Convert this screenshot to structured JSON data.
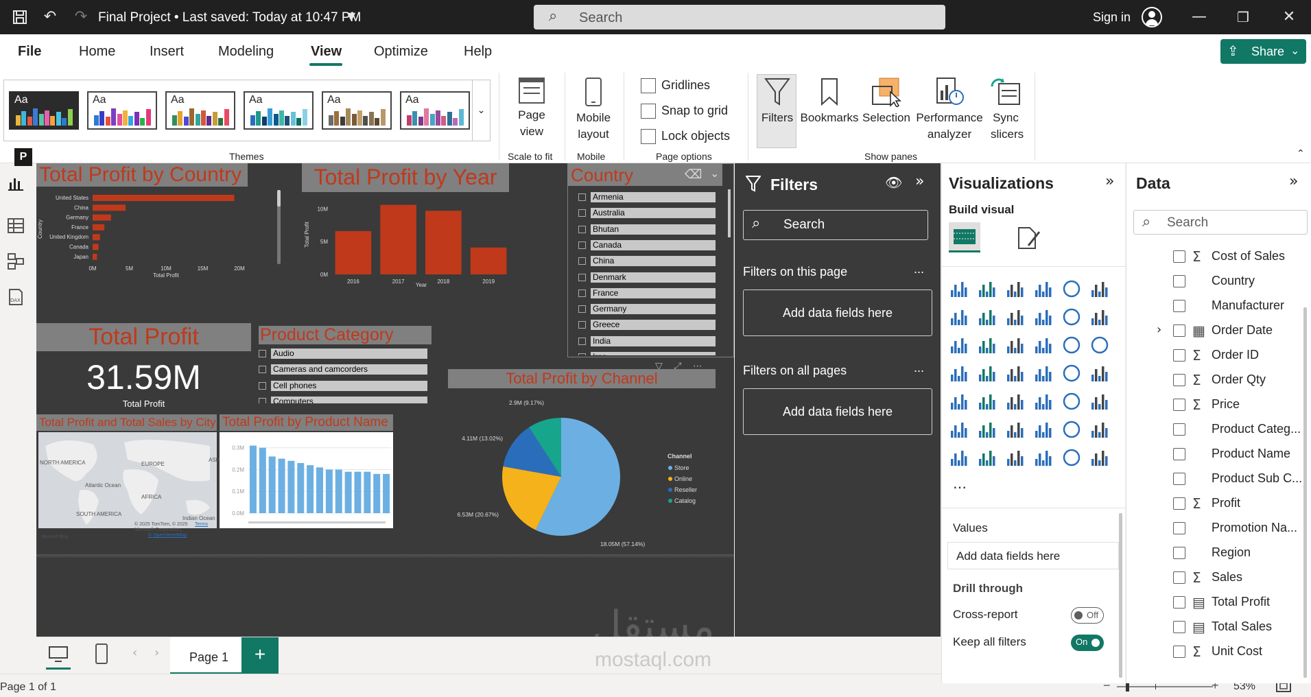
{
  "titlebar": {
    "doc_title": "Final Project • Last saved: Today at 10:47 PM",
    "search_placeholder": "Search",
    "signin": "Sign in"
  },
  "menu": {
    "items": [
      "File",
      "Home",
      "Insert",
      "Modeling",
      "View",
      "Optimize",
      "Help"
    ],
    "active": "View",
    "share": "Share"
  },
  "ribbon": {
    "themes_label": "Themes",
    "page_view": "Page view",
    "scale_to_fit": "Scale to fit",
    "mobile_layout": "Mobile layout",
    "mobile": "Mobile",
    "gridlines": "Gridlines",
    "snap_to_grid": "Snap to grid",
    "lock_objects": "Lock objects",
    "page_options": "Page options",
    "filters": "Filters",
    "bookmarks": "Bookmarks",
    "selection": "Selection",
    "performance_analyzer": "Performance analyzer",
    "sync_slicers": "Sync slicers",
    "show_panes": "Show panes"
  },
  "report": {
    "profit_by_country": {
      "title": "Total Profit by Country",
      "ylabel": "Country",
      "xlabel": "Total Profit"
    },
    "profit_by_year": {
      "title": "Total Profit by Year",
      "ylabel": "Total Profit",
      "xlabel": "Year"
    },
    "country_slicer": {
      "title": "Country",
      "items": [
        "Armenia",
        "Australia",
        "Bhutan",
        "Canada",
        "China",
        "Denmark",
        "France",
        "Germany",
        "Greece",
        "India",
        "Iran"
      ]
    },
    "total_profit_card": {
      "title": "Total Profit",
      "value": "31.59M",
      "label": "Total Profit"
    },
    "product_category_slicer": {
      "title": "Product Category",
      "items": [
        "Audio",
        "Cameras and camcorders",
        "Cell phones",
        "Computers"
      ]
    },
    "profit_by_channel": {
      "title": "Total Profit by Channel",
      "legend_title": "Channel",
      "slice_labels": [
        "18.05M (57.14%)",
        "6.53M (20.67%)",
        "4.11M (13.02%)",
        "2.9M (9.17%)"
      ]
    },
    "map": {
      "title": "Total Profit and Total Sales by City",
      "labels": [
        "NORTH AMERICA",
        "EUROPE",
        "ASIA",
        "Atlantic Ocean",
        "AFRICA",
        "SOUTH AMERICA",
        "Indian Ocean"
      ],
      "attribution_1": "© 2025 TomTom, © 2025",
      "attribution_terms": "Terms",
      "attribution_2": "Microsoft Corporation,",
      "attribution_3": "© OpenStreetMap",
      "bing": "Microsoft Bing"
    },
    "profit_by_product": {
      "title": "Total Profit by Product Name"
    }
  },
  "chart_data": [
    {
      "type": "bar",
      "orientation": "horizontal",
      "categories": [
        "United States",
        "China",
        "Germany",
        "France",
        "United Kingdom",
        "Canada",
        "Japan"
      ],
      "values": [
        19.3,
        4.5,
        2.5,
        1.6,
        1.0,
        0.8,
        0.6
      ],
      "title": "Total Profit by Country",
      "xlabel": "Total Profit",
      "ylabel": "Country",
      "xticks": [
        "0M",
        "5M",
        "10M",
        "15M",
        "20M"
      ],
      "xlim": [
        0,
        20
      ],
      "unit": "M"
    },
    {
      "type": "bar",
      "categories": [
        "2016",
        "2017",
        "2018",
        "2019"
      ],
      "values": [
        6.6,
        10.6,
        9.7,
        4.1
      ],
      "title": "Total Profit by Year",
      "xlabel": "Year",
      "ylabel": "Total Profit",
      "yticks": [
        "0M",
        "5M",
        "10M"
      ],
      "ylim": [
        0,
        11.5
      ],
      "unit": "M"
    },
    {
      "type": "pie",
      "title": "Total Profit by Channel",
      "categories": [
        "Store",
        "Online",
        "Reseller",
        "Catalog"
      ],
      "values": [
        18.05,
        6.53,
        4.11,
        2.9
      ],
      "percent": [
        57.14,
        20.67,
        13.02,
        9.17
      ],
      "colors": [
        "#6cb0e3",
        "#f6b21b",
        "#2a6ebb",
        "#17a58c"
      ],
      "legend": "right"
    },
    {
      "type": "bar",
      "title": "Total Profit by Product Name",
      "values": [
        0.31,
        0.3,
        0.26,
        0.25,
        0.24,
        0.23,
        0.22,
        0.21,
        0.2,
        0.2,
        0.19,
        0.19,
        0.19,
        0.18,
        0.18
      ],
      "yticks": [
        "0.0M",
        "0.1M",
        "0.2M",
        "0.3M"
      ],
      "ylim": [
        0,
        0.34
      ],
      "unit": "M"
    }
  ],
  "pages": {
    "tab": "Page 1",
    "status": "Page 1 of 1",
    "zoom": "53%"
  },
  "filters_pane": {
    "title": "Filters",
    "search_placeholder": "Search",
    "on_this_page": "Filters on this page",
    "on_all_pages": "Filters on all pages",
    "add_fields": "Add data fields here",
    "more": "..."
  },
  "viz_pane": {
    "title": "Visualizations",
    "build_visual": "Build visual",
    "values": "Values",
    "add_fields": "Add data fields here",
    "drill_through": "Drill through",
    "cross_report": "Cross-report",
    "cross_report_state": "Off",
    "keep_all_filters": "Keep all filters",
    "keep_all_filters_state": "On"
  },
  "data_pane": {
    "title": "Data",
    "search_placeholder": "Search",
    "fields": [
      {
        "name": "Cost of Sales",
        "icon": "sigma"
      },
      {
        "name": "Country",
        "icon": ""
      },
      {
        "name": "Manufacturer",
        "icon": ""
      },
      {
        "name": "Order Date",
        "icon": "calendar",
        "expandable": true
      },
      {
        "name": "Order ID",
        "icon": "sigma"
      },
      {
        "name": "Order Qty",
        "icon": "sigma"
      },
      {
        "name": "Price",
        "icon": "sigma"
      },
      {
        "name": "Product Categ...",
        "icon": ""
      },
      {
        "name": "Product Name",
        "icon": ""
      },
      {
        "name": "Product Sub C...",
        "icon": ""
      },
      {
        "name": "Profit",
        "icon": "sigma"
      },
      {
        "name": "Promotion Na...",
        "icon": ""
      },
      {
        "name": "Region",
        "icon": ""
      },
      {
        "name": "Sales",
        "icon": "sigma"
      },
      {
        "name": "Total Profit",
        "icon": "calculator"
      },
      {
        "name": "Total Sales",
        "icon": "calculator"
      },
      {
        "name": "Unit Cost",
        "icon": "sigma"
      }
    ]
  },
  "watermark": {
    "arabic": "مستقل",
    "latin": "mostaql.com"
  },
  "colors": {
    "accent": "#117865",
    "bar": "#c0391b",
    "title_text": "#c0391b",
    "canvas": "#3a3a3a",
    "product_bar": "#6cb0e3"
  }
}
